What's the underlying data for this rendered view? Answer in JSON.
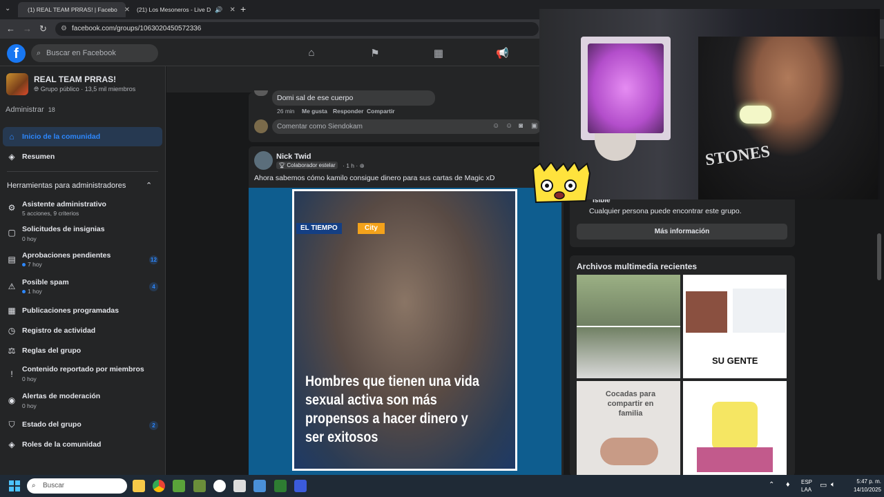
{
  "browser": {
    "tabs": [
      {
        "title": "(1) REAL TEAM PRRAS! | Facebo",
        "active": true
      },
      {
        "title": "(21) Los Mesoneros - Live D",
        "active": false
      }
    ],
    "new_tab": "+",
    "url": "facebook.com/groups/1063020450572336"
  },
  "fb": {
    "logo": "f",
    "search_placeholder": "Buscar en Facebook"
  },
  "group": {
    "name": "REAL TEAM PRRAS!",
    "meta": "Grupo público · 13,5 mil miembros",
    "admin_label": "Administrar",
    "admin_count": "18"
  },
  "sidebar": {
    "top_items": [
      {
        "label": "Inicio de la comunidad",
        "icon": "home-icon"
      },
      {
        "label": "Resumen",
        "icon": "layers-icon"
      }
    ],
    "tools_title": "Herramientas para administradores",
    "tools": [
      {
        "label": "Asistente administrativo",
        "sub": "5 acciones, 9 criterios",
        "badge": ""
      },
      {
        "label": "Solicitudes de insignias",
        "sub": "0 hoy",
        "badge": ""
      },
      {
        "label": "Aprobaciones pendientes",
        "sub": "7 hoy",
        "badge": "12"
      },
      {
        "label": "Posible spam",
        "sub": "1 hoy",
        "badge": "4"
      },
      {
        "label": "Publicaciones programadas",
        "sub": "",
        "badge": ""
      },
      {
        "label": "Registro de actividad",
        "sub": "",
        "badge": ""
      },
      {
        "label": "Reglas del grupo",
        "sub": "",
        "badge": ""
      },
      {
        "label": "Contenido reportado por miembros",
        "sub": "0 hoy",
        "badge": ""
      },
      {
        "label": "Alertas de moderación",
        "sub": "0 hoy",
        "badge": ""
      },
      {
        "label": "Estado del grupo",
        "sub": "",
        "badge": "2"
      },
      {
        "label": "Roles de la comunidad",
        "sub": "",
        "badge": ""
      }
    ]
  },
  "comment": {
    "text": "Domi sal de ese cuerpo",
    "time": "26 min",
    "like": "Me gusta",
    "reply": "Responder",
    "share": "Compartir",
    "input_placeholder": "Comentar como Siendokam"
  },
  "post": {
    "author": "Nick Twid",
    "badge": "Colaborador estelar",
    "time": "· 1 h ·",
    "text": "Ahora sabemos cómo kamilo consigue dinero para sus cartas de Magic xD",
    "media_tag1": "EL TIEMPO",
    "media_tag2": "City",
    "media_caption": "Hombres que tienen una vida sexual activa son más propensos a hacer dinero y ser exitosos"
  },
  "right": {
    "visible_fragment": "isible",
    "visibility_text": "Cualquier persona puede encontrar este grupo.",
    "more_button": "Más información",
    "media_title": "Archivos multimedia recientes",
    "thumb_text_1": "SU GENTE",
    "thumb_text_2": "Cocadas para compartir en familia"
  },
  "webcam": {
    "shirt_text": "STONES"
  },
  "taskbar": {
    "search_placeholder": "Buscar",
    "lang": "ESP",
    "lang2": "LAA",
    "time": "5:47 p. m.",
    "date": "14/10/2025"
  }
}
